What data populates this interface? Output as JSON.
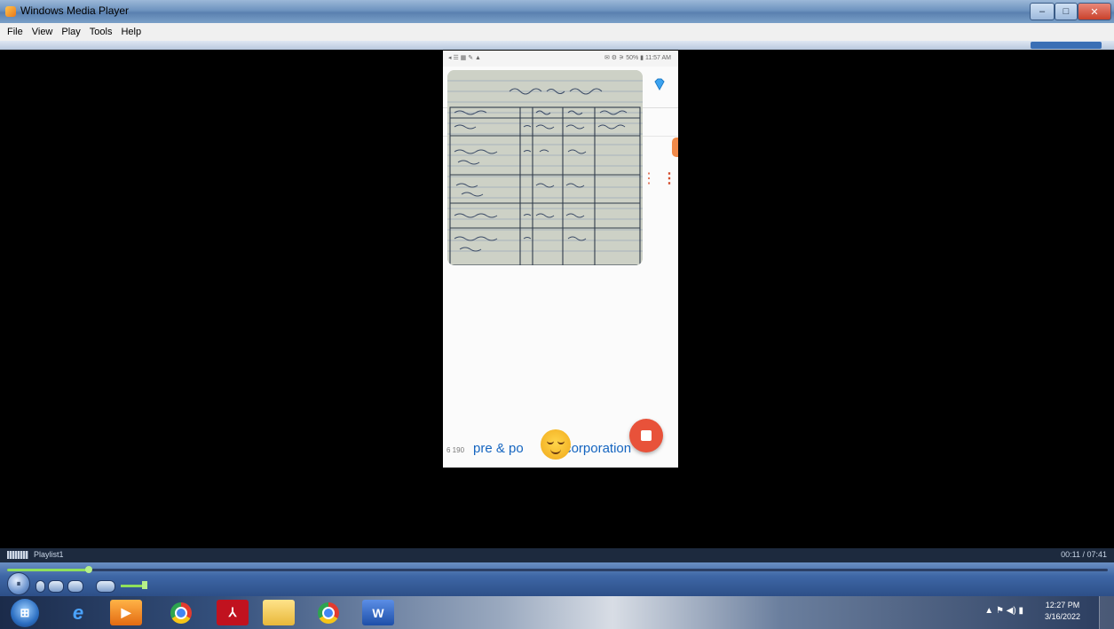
{
  "window": {
    "title": "Windows Media Player",
    "controls": {
      "minimize": "–",
      "maximize": "□",
      "close": "✕"
    }
  },
  "menu": [
    "File",
    "View",
    "Play",
    "Tools",
    "Help"
  ],
  "phone": {
    "status_left": "◂ ☰ ▦ ✎ ▲",
    "status_right": "✉ ⚙ ⚞ 50% ▮ 11:57 AM",
    "ticker_left": "pre & po",
    "ticker_right": "corporation",
    "small_num": "6 190"
  },
  "playlist": {
    "label": "Playlist1",
    "time": "00:11 / 07:41"
  },
  "controls": {
    "play_icon": "⏸",
    "seek_progress": 0.024
  },
  "taskbar": {
    "start_icon": "windows-start-icon",
    "apps": [
      "internet-explorer-icon",
      "media-player-icon",
      "chrome-icon",
      "acrobat-icon",
      "file-explorer-icon",
      "chrome-profile-icon",
      "word-icon"
    ],
    "tray": "▲ ⚑ ◀) ▮",
    "time": "12:27 PM",
    "date": "3/16/2022"
  }
}
